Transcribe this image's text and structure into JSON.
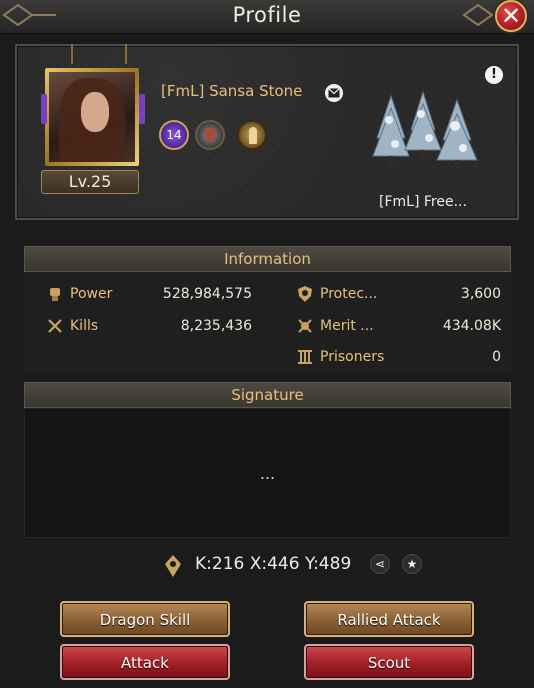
{
  "window": {
    "title": "Profile",
    "close_label": "✕"
  },
  "profile": {
    "level_label": "Lv.25",
    "player_name": "[FmL] Sansa Stone",
    "badge_level": "14",
    "info_icon_label": "!",
    "alliance_name": "[FmL] Free..."
  },
  "information": {
    "header": "Information",
    "stats": [
      {
        "label": "Power",
        "value": "528,984,575",
        "icon": "fist-icon"
      },
      {
        "label": "Kills",
        "value": "8,235,436",
        "icon": "crossed-swords-icon"
      },
      {
        "label": "Protec...",
        "value": "3,600",
        "icon": "shield-icon"
      },
      {
        "label": "Merit ...",
        "value": "434.08K",
        "icon": "merit-icon"
      },
      {
        "label": "Prisoners",
        "value": "0",
        "icon": "prison-bars-icon"
      }
    ]
  },
  "signature": {
    "header": "Signature",
    "text": "..."
  },
  "location": {
    "coords": "K:216 X:446 Y:489",
    "share_glyph": "⋖",
    "favorite_glyph": "★"
  },
  "actions": {
    "dragon_skill": "Dragon Skill",
    "rallied_attack": "Rallied Attack",
    "attack": "Attack",
    "scout": "Scout"
  },
  "colors": {
    "accent_gold": "#e8c07a",
    "button_red": "#a21f26",
    "button_brown": "#8a5f34"
  }
}
